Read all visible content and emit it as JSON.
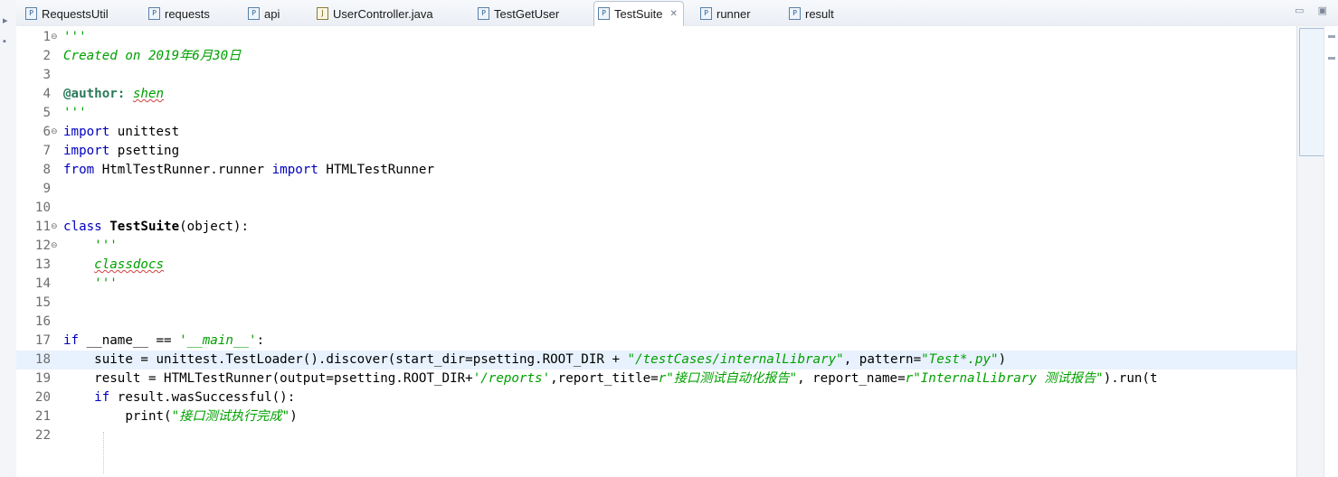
{
  "tabs": [
    {
      "label": "RequestsUtil",
      "icon": "python-file-icon"
    },
    {
      "label": "requests",
      "icon": "python-file-icon"
    },
    {
      "label": "api",
      "icon": "python-file-icon"
    },
    {
      "label": "UserController.java",
      "icon": "java-file-icon"
    },
    {
      "label": "TestGetUser",
      "icon": "python-file-icon"
    },
    {
      "label": "TestSuite",
      "icon": "python-file-icon",
      "active": true
    },
    {
      "label": "runner",
      "icon": "python-file-icon"
    },
    {
      "label": "result",
      "icon": "python-file-icon"
    }
  ],
  "tab_icon_glyph": "P",
  "java_icon_glyph": "J",
  "close_glyph": "✕",
  "view_controls": {
    "minimize": "▭",
    "maximize": "▣"
  },
  "editor": {
    "lines": [
      {
        "n": "1",
        "fold": "⊖",
        "parts": [
          {
            "t": "'''",
            "c": "str-doc"
          }
        ]
      },
      {
        "n": "2",
        "parts": [
          {
            "t": "Created on 2019年6月30日",
            "c": "str-doc"
          }
        ]
      },
      {
        "n": "3",
        "parts": []
      },
      {
        "n": "4",
        "parts": [
          {
            "t": "@author:",
            "c": "deco"
          },
          {
            "t": " ",
            "c": ""
          },
          {
            "t": "shen",
            "c": "str-doc squig"
          }
        ]
      },
      {
        "n": "5",
        "parts": [
          {
            "t": "'''",
            "c": "str-doc"
          }
        ]
      },
      {
        "n": "6",
        "fold": "⊖",
        "parts": [
          {
            "t": "import",
            "c": "kw"
          },
          {
            "t": " unittest",
            "c": ""
          }
        ]
      },
      {
        "n": "7",
        "parts": [
          {
            "t": "import",
            "c": "kw"
          },
          {
            "t": " psetting",
            "c": ""
          }
        ]
      },
      {
        "n": "8",
        "parts": [
          {
            "t": "from",
            "c": "kw"
          },
          {
            "t": " HtmlTestRunner.runner ",
            "c": ""
          },
          {
            "t": "import",
            "c": "kw"
          },
          {
            "t": " HTMLTestRunner",
            "c": ""
          }
        ]
      },
      {
        "n": "9",
        "parts": []
      },
      {
        "n": "10",
        "parts": []
      },
      {
        "n": "11",
        "fold": "⊖",
        "parts": [
          {
            "t": "class",
            "c": "kw"
          },
          {
            "t": " ",
            "c": ""
          },
          {
            "t": "TestSuite",
            "c": "cls"
          },
          {
            "t": "(object):",
            "c": ""
          }
        ]
      },
      {
        "n": "12",
        "fold": "⊖",
        "parts": [
          {
            "t": "    ",
            "c": ""
          },
          {
            "t": "'''",
            "c": "str-doc"
          }
        ]
      },
      {
        "n": "13",
        "parts": [
          {
            "t": "    ",
            "c": ""
          },
          {
            "t": "classdocs",
            "c": "str-doc squig"
          }
        ]
      },
      {
        "n": "14",
        "parts": [
          {
            "t": "    ",
            "c": ""
          },
          {
            "t": "'''",
            "c": "str-doc"
          }
        ]
      },
      {
        "n": "15",
        "parts": []
      },
      {
        "n": "16",
        "parts": []
      },
      {
        "n": "17",
        "parts": [
          {
            "t": "if",
            "c": "kw"
          },
          {
            "t": " __name__ == ",
            "c": ""
          },
          {
            "t": "'__main__'",
            "c": "str"
          },
          {
            "t": ":",
            "c": ""
          }
        ]
      },
      {
        "n": "18",
        "current": true,
        "parts": [
          {
            "t": "    suite = unittest.TestLoader().discover(start_dir=psetting.ROOT_DIR + ",
            "c": ""
          },
          {
            "t": "\"/testCases/internalLibrary\"",
            "c": "str"
          },
          {
            "t": ", pattern=",
            "c": ""
          },
          {
            "t": "\"Test*.py\"",
            "c": "str"
          },
          {
            "t": ")",
            "c": ""
          }
        ]
      },
      {
        "n": "19",
        "parts": [
          {
            "t": "    result = HTMLTestRunner(output=psetting.ROOT_DIR+",
            "c": ""
          },
          {
            "t": "'/reports'",
            "c": "str"
          },
          {
            "t": ",report_title=",
            "c": ""
          },
          {
            "t": "r\"接口测试自动化报告\"",
            "c": "str"
          },
          {
            "t": ", report_name=",
            "c": ""
          },
          {
            "t": "r\"InternalLibrary 测试报告\"",
            "c": "str"
          },
          {
            "t": ").run(t",
            "c": ""
          }
        ]
      },
      {
        "n": "20",
        "parts": [
          {
            "t": "    ",
            "c": ""
          },
          {
            "t": "if",
            "c": "kw"
          },
          {
            "t": " result.wasSuccessful():",
            "c": ""
          }
        ]
      },
      {
        "n": "21",
        "parts": [
          {
            "t": "        print(",
            "c": ""
          },
          {
            "t": "\"接口测试执行完成\"",
            "c": "str"
          },
          {
            "t": ")",
            "c": ""
          }
        ]
      },
      {
        "n": "22",
        "parts": []
      }
    ]
  }
}
